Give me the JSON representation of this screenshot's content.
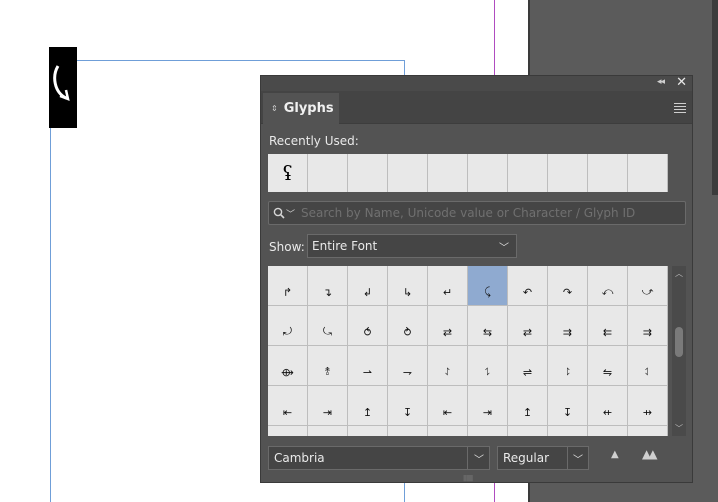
{
  "document": {
    "frame_glyph": "⤹"
  },
  "panel": {
    "title": "Glyphs",
    "tab_arrows": "⇕",
    "collapse_icon": "◂◂",
    "close_icon": "✕",
    "recently_used_label": "Recently Used:",
    "recently_used": [
      "ʢ",
      "",
      "",
      "",
      "",
      "",
      "",
      "",
      "",
      ""
    ],
    "search": {
      "placeholder": "Search by Name, Unicode value or Character / Glyph ID",
      "value": ""
    },
    "show_label": "Show:",
    "show_value": "Entire Font",
    "glyph_grid": [
      [
        "↱",
        "↴",
        "↲",
        "↳",
        "↵",
        "⤹",
        "↶",
        "↷",
        "⤺",
        "⤻"
      ],
      [
        "⤾",
        "⤿",
        "⥀",
        "⥁",
        "⇄",
        "⇆",
        "⇄",
        "⇉",
        "⇇",
        "⇉"
      ],
      [
        "⟴",
        "⥉",
        "⇀",
        "⇁",
        "⥌",
        "⥍",
        "⇌",
        "⥏",
        "⇋",
        "⥑"
      ],
      [
        "⇤",
        "⇥",
        "↥",
        "↧",
        "⇤",
        "⇥",
        "↥",
        "↧",
        "⇷",
        "⇸"
      ],
      [
        "",
        "",
        "",
        "",
        "",
        "",
        "",
        "",
        "",
        ""
      ]
    ],
    "selected_glyph_index": [
      0,
      5
    ],
    "font_family": "Cambria",
    "font_style": "Regular",
    "size_small_icon": "▲",
    "size_large_icon": "▲▲",
    "grip_icon": "|||||||||"
  }
}
